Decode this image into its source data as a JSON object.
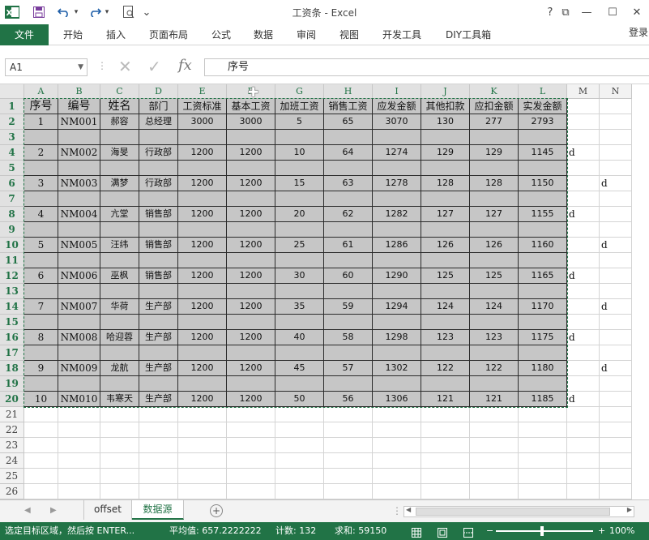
{
  "window": {
    "title": "工资条 - Excel",
    "help_glyph": "?",
    "restore_glyph": "⧉",
    "minimize_glyph": "—",
    "maximize_glyph": "☐",
    "close_glyph": "✕",
    "signin": "登录"
  },
  "qat": {
    "excel_icon": "excel-logo-icon",
    "save_icon": "save-icon",
    "undo_icon": "undo-icon",
    "redo_icon": "redo-icon",
    "preview_icon": "print-preview-icon",
    "more_glyph": "⌄"
  },
  "ribbon": {
    "tabs": [
      "文件",
      "开始",
      "插入",
      "页面布局",
      "公式",
      "数据",
      "审阅",
      "视图",
      "开发工具",
      "DIY工具箱"
    ]
  },
  "formula_bar": {
    "name_box": "A1",
    "cancel_glyph": "✕",
    "enter_glyph": "✓",
    "fx_glyph": "fx",
    "content": "序号"
  },
  "grid": {
    "columns": [
      "A",
      "B",
      "C",
      "D",
      "E",
      "F",
      "G",
      "H",
      "I",
      "J",
      "K",
      "L",
      "M",
      "N"
    ],
    "header_row": [
      "序号",
      "编号",
      "姓名",
      "部门",
      "工资标准",
      "基本工资",
      "加班工资",
      "销售工资",
      "应发金额",
      "其他扣款",
      "应扣金额",
      "实发金额"
    ],
    "records": [
      [
        "1",
        "NM001",
        "郝容",
        "总经理",
        "3000",
        "3000",
        "5",
        "65",
        "3070",
        "130",
        "277",
        "2793"
      ],
      [
        "2",
        "NM002",
        "海旻",
        "行政部",
        "1200",
        "1200",
        "10",
        "64",
        "1274",
        "129",
        "129",
        "1145"
      ],
      [
        "3",
        "NM003",
        "满梦",
        "行政部",
        "1200",
        "1200",
        "15",
        "63",
        "1278",
        "128",
        "128",
        "1150"
      ],
      [
        "4",
        "NM004",
        "亢堂",
        "销售部",
        "1200",
        "1200",
        "20",
        "62",
        "1282",
        "127",
        "127",
        "1155"
      ],
      [
        "5",
        "NM005",
        "汪纬",
        "销售部",
        "1200",
        "1200",
        "25",
        "61",
        "1286",
        "126",
        "126",
        "1160"
      ],
      [
        "6",
        "NM006",
        "巫枫",
        "销售部",
        "1200",
        "1200",
        "30",
        "60",
        "1290",
        "125",
        "125",
        "1165"
      ],
      [
        "7",
        "NM007",
        "华荷",
        "生产部",
        "1200",
        "1200",
        "35",
        "59",
        "1294",
        "124",
        "124",
        "1170"
      ],
      [
        "8",
        "NM008",
        "哈迎蓉",
        "生产部",
        "1200",
        "1200",
        "40",
        "58",
        "1298",
        "123",
        "123",
        "1175"
      ],
      [
        "9",
        "NM009",
        "龙航",
        "生产部",
        "1200",
        "1200",
        "45",
        "57",
        "1302",
        "122",
        "122",
        "1180"
      ],
      [
        "10",
        "NM010",
        "韦寒天",
        "生产部",
        "1200",
        "1200",
        "50",
        "56",
        "1306",
        "121",
        "121",
        "1185"
      ]
    ],
    "row_numbers": [
      "1",
      "2",
      "3",
      "4",
      "5",
      "6",
      "7",
      "8",
      "9",
      "10",
      "11",
      "12",
      "13",
      "14",
      "15",
      "16",
      "17",
      "18",
      "19",
      "20",
      "21",
      "22",
      "23",
      "24",
      "25",
      "26"
    ],
    "m_column_marks": {
      "4": "d",
      "8": "d",
      "12": "d",
      "16": "d",
      "20": "d"
    },
    "n_column_marks": {
      "6": "d",
      "10": "d",
      "14": "d",
      "18": "d"
    }
  },
  "sheets": {
    "tabs": [
      "offset",
      "数据源"
    ],
    "active": "数据源",
    "add_glyph": "+",
    "prev_glyph": "◀",
    "next_glyph": "▶"
  },
  "status": {
    "message": "选定目标区域，然后按 ENTER...",
    "average": "平均值: 657.2222222",
    "count": "计数: 132",
    "sum": "求和: 59150",
    "zoom_minus": "−",
    "zoom_plus": "+",
    "zoom": "100%",
    "zoom_level_percent": 100
  },
  "colors": {
    "accent": "#217346",
    "selection_fill": "#c6c6c6"
  }
}
